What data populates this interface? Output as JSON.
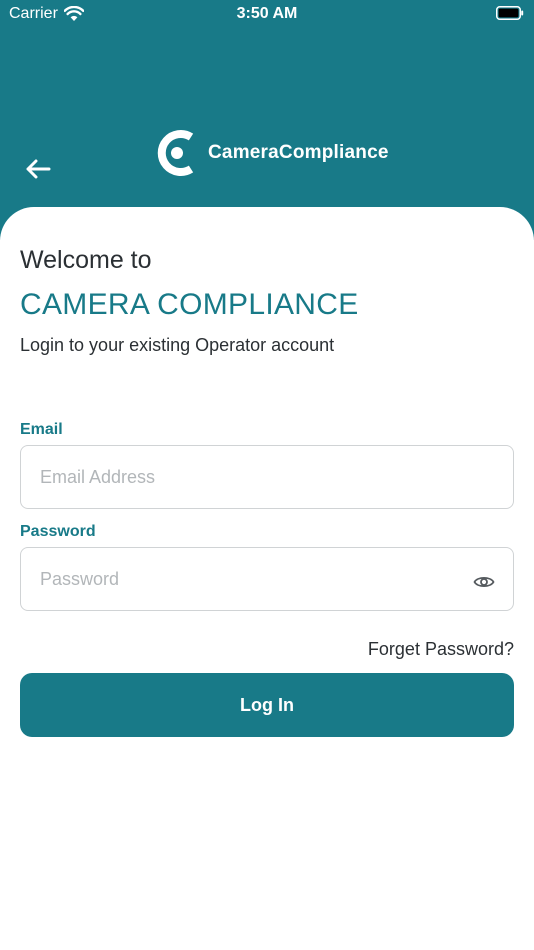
{
  "status_bar": {
    "carrier": "Carrier",
    "time": "3:50 AM"
  },
  "header": {
    "logo_text": "CameraCompliance",
    "back_icon": "arrow-left-icon"
  },
  "login": {
    "welcome": "Welcome to",
    "brand_title": "CAMERA COMPLIANCE",
    "subtitle": "Login to your existing Operator account",
    "email_label": "Email",
    "email_placeholder": "Email Address",
    "email_value": "",
    "password_label": "Password",
    "password_placeholder": "Password",
    "password_value": "",
    "forgot_label": "Forget Password?",
    "login_label": "Log In"
  },
  "colors": {
    "primary": "#187a88",
    "text": "#2b3034",
    "placeholder": "#b2b6b9",
    "border": "#d0d3d5",
    "background": "#ffffff"
  }
}
